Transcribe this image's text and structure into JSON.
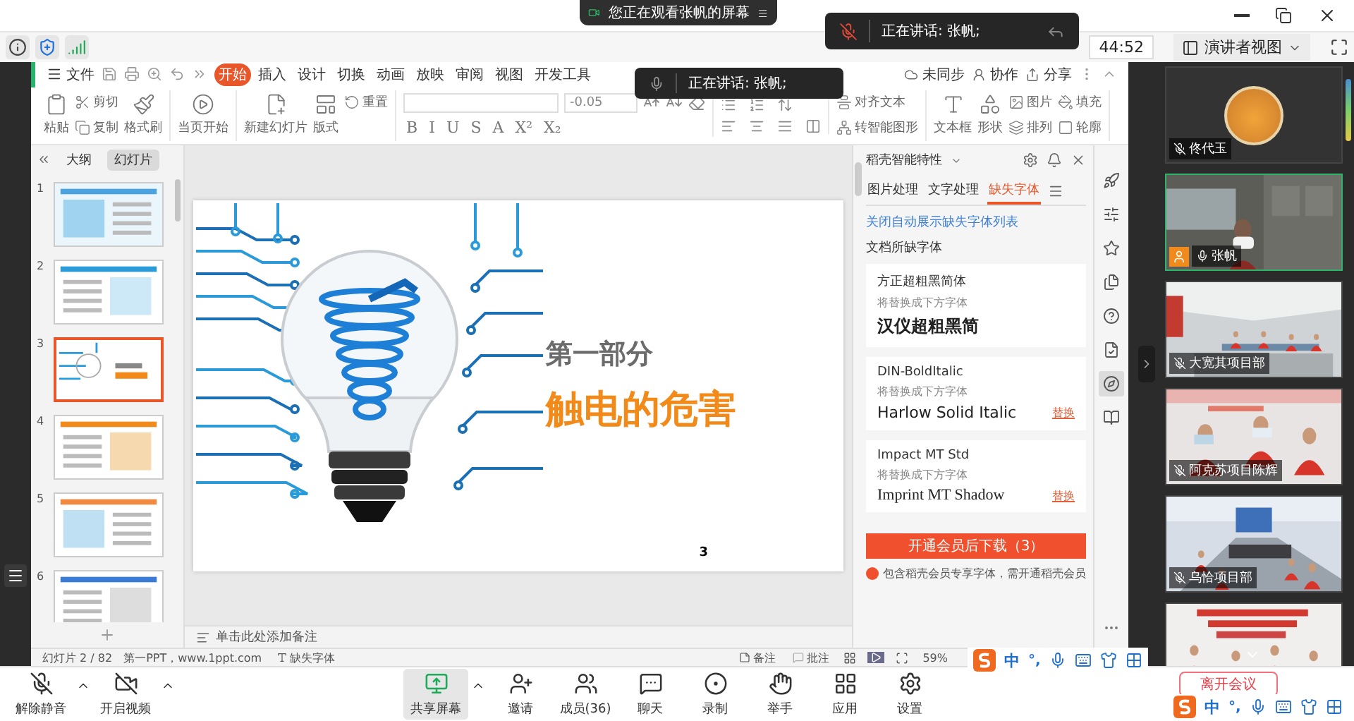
{
  "screen_share_banner": "您正在观看张帆的屏幕",
  "speaker_notice": "正在讲话: 张帆;",
  "meeting_bar": {
    "timer": "44:52",
    "view_mode": "演讲者视图"
  },
  "wps": {
    "speaker_notice": "正在讲话: 张帆;",
    "file_menu": "文件",
    "tabs": [
      {
        "label": "开始",
        "selected": true
      },
      {
        "label": "插入",
        "selected": false
      },
      {
        "label": "设计",
        "selected": false
      },
      {
        "label": "切换",
        "selected": false
      },
      {
        "label": "动画",
        "selected": false
      },
      {
        "label": "放映",
        "selected": false
      },
      {
        "label": "审阅",
        "selected": false
      },
      {
        "label": "视图",
        "selected": false
      },
      {
        "label": "开发工具",
        "selected": false
      }
    ],
    "actions": [
      "未同步",
      "协作",
      "分享"
    ],
    "ribbon": {
      "clipboard": [
        {
          "label": "粘贴",
          "kind": "large"
        },
        {
          "label": "剪切",
          "kind": "small"
        },
        {
          "label": "复制",
          "kind": "small"
        },
        {
          "label": "格式刷",
          "kind": "large"
        }
      ],
      "start": [
        {
          "label": "当页开始",
          "kind": "large"
        }
      ],
      "slides": [
        {
          "label": "新建幻灯片",
          "kind": "large"
        },
        {
          "label": "版式",
          "kind": "large"
        },
        {
          "label": "重置",
          "kind": "small"
        }
      ],
      "font_size": "-0.05",
      "format_buttons": [
        "B",
        "I",
        "U",
        "S",
        "A",
        "X²",
        "X₂"
      ],
      "paragraph": [
        {
          "label": "对齐文本",
          "kind": "small"
        },
        {
          "label": "转智能图形",
          "kind": "small"
        }
      ],
      "insert": [
        {
          "label": "文本框",
          "kind": "large"
        },
        {
          "label": "形状",
          "kind": "large"
        },
        {
          "label": "图片",
          "kind": "small"
        },
        {
          "label": "排列",
          "kind": "small"
        },
        {
          "label": "填充",
          "kind": "small"
        },
        {
          "label": "轮廓",
          "kind": "small"
        }
      ]
    },
    "pane_tabs": [
      {
        "label": "大纲",
        "selected": false
      },
      {
        "label": "幻灯片",
        "selected": true
      }
    ],
    "thumbnails": [
      {
        "number": "1",
        "selected": false
      },
      {
        "number": "2",
        "selected": false
      },
      {
        "number": "3",
        "selected": true
      },
      {
        "number": "4",
        "selected": false
      },
      {
        "number": "5",
        "selected": false
      },
      {
        "number": "6",
        "selected": false
      }
    ],
    "slide": {
      "subtitle": "第一部分",
      "title": "触电的危害",
      "page": "3"
    },
    "notes_placeholder": "单击此处添加备注",
    "panel": {
      "title": "稻壳智能特性",
      "tabs": [
        {
          "label": "图片处理",
          "selected": false
        },
        {
          "label": "文字处理",
          "selected": false
        },
        {
          "label": "缺失字体",
          "selected": true
        }
      ],
      "link": "关闭自动展示缺失字体列表",
      "section": "文档所缺字体",
      "fonts": [
        {
          "missing": "方正超粗黑简体",
          "hint": "将替换成下方字体",
          "replacement": "汉仪超粗黑简",
          "kind": "bold"
        },
        {
          "missing": "DIN-BoldItalic",
          "hint": "将替换成下方字体",
          "replacement": "Harlow Solid Italic",
          "kind": "sans",
          "action": "替换"
        },
        {
          "missing": "Impact MT Std",
          "hint": "将替换成下方字体",
          "replacement": "Imprint MT Shadow",
          "kind": "serif",
          "action": "替换"
        }
      ],
      "button": "开通会员后下载（3）",
      "note": "包含稻壳会员专享字体，需开通稻壳会员"
    },
    "side_tools": [
      {
        "selected": false
      },
      {
        "selected": false
      },
      {
        "selected": false
      },
      {
        "selected": false
      },
      {
        "selected": false
      },
      {
        "selected": false
      },
      {
        "selected": true
      },
      {
        "selected": false
      }
    ],
    "status": {
      "slide": "幻灯片 2 / 82",
      "source": "第一PPT，www.1ppt.com",
      "missing_fonts": "缺失字体",
      "notes": "备注",
      "comments": "批注",
      "zoom": "59%"
    }
  },
  "participants": [
    {
      "name": "佟代玉",
      "kind": "avatar",
      "muted": true,
      "speaking": false,
      "presenter": false
    },
    {
      "name": "张帆",
      "kind": "video",
      "muted": false,
      "speaking": true,
      "presenter": true
    },
    {
      "name": "大宽其项目部",
      "kind": "video",
      "muted": true,
      "speaking": false,
      "presenter": false
    },
    {
      "name": "阿克苏项目陈辉",
      "kind": "video",
      "muted": true,
      "speaking": false,
      "presenter": false
    },
    {
      "name": "乌恰项目部",
      "kind": "video",
      "muted": true,
      "speaking": false,
      "presenter": false
    },
    {
      "kind": "video",
      "speaking": false
    }
  ],
  "media_buttons": [
    {
      "label": "解除静音",
      "caret": true
    },
    {
      "label": "开启视频",
      "caret": true
    }
  ],
  "meeting_buttons": [
    {
      "label": "共享屏幕",
      "selected": true,
      "caret": true
    },
    {
      "label": "邀请",
      "selected": false,
      "caret": false
    },
    {
      "label": "成员(36)",
      "selected": false,
      "caret": false
    },
    {
      "label": "聊天",
      "selected": false,
      "caret": false
    },
    {
      "label": "录制",
      "selected": false,
      "caret": false
    },
    {
      "label": "举手",
      "selected": false,
      "caret": false
    },
    {
      "label": "应用",
      "selected": false,
      "caret": false
    },
    {
      "label": "设置",
      "selected": false,
      "caret": false
    }
  ],
  "leave_button": "离开会议",
  "ime_bars": [
    {
      "mode": "中",
      "punct": "°,"
    },
    {
      "mode": "中",
      "punct": "°,"
    }
  ]
}
